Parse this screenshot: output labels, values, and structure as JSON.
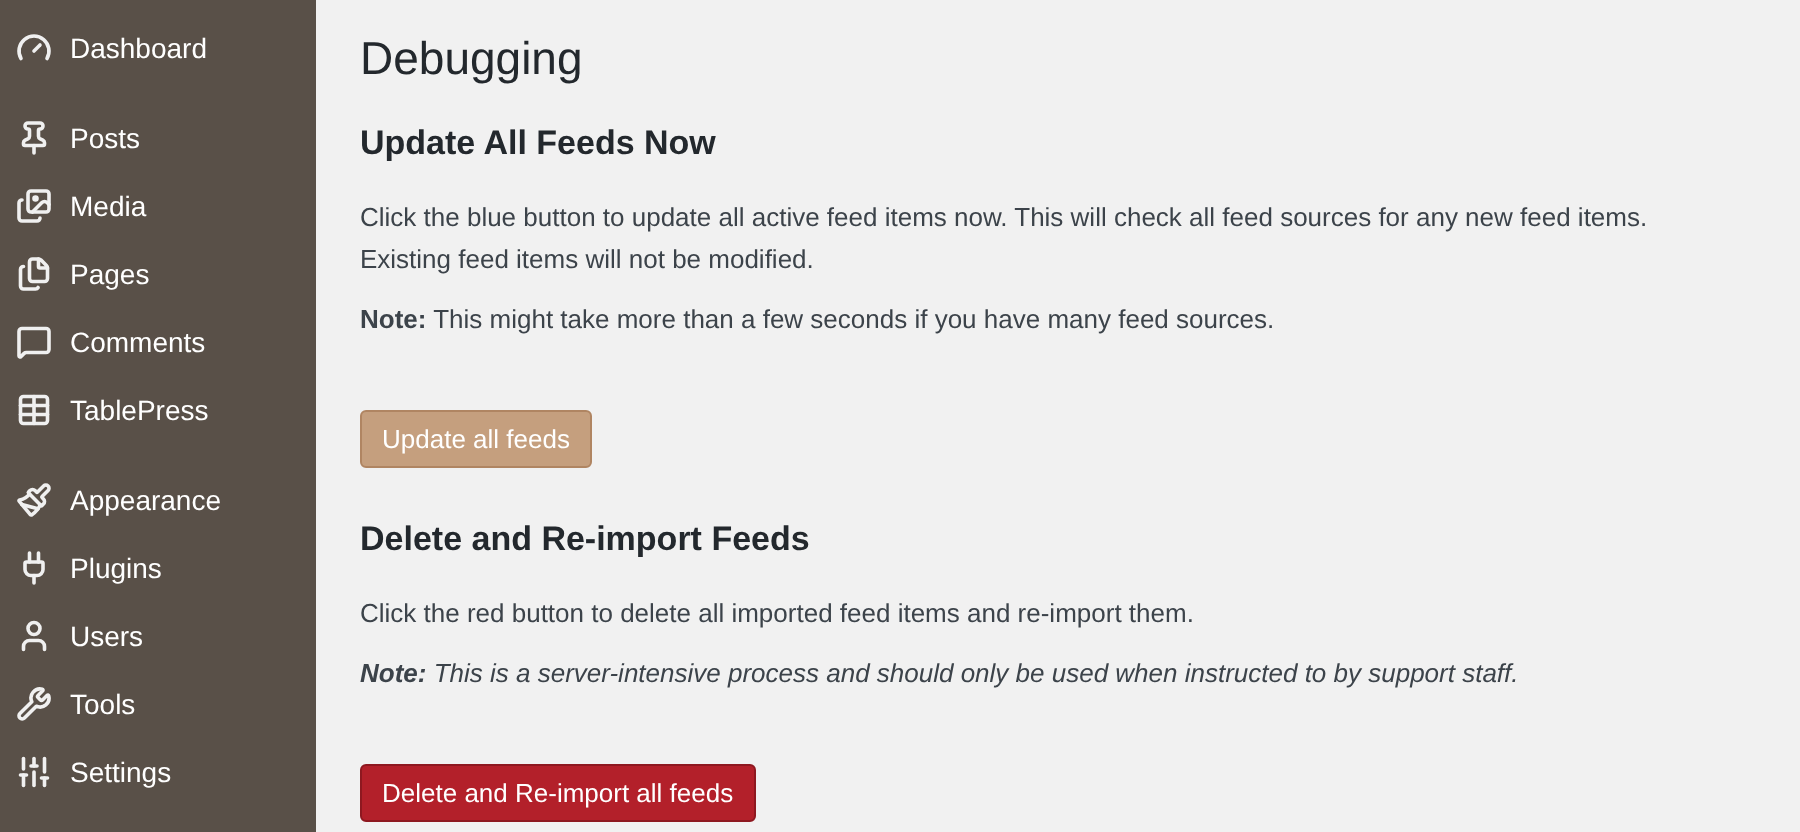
{
  "sidebar": {
    "groups": [
      {
        "items": [
          {
            "label": "Dashboard"
          }
        ]
      },
      {
        "items": [
          {
            "label": "Posts"
          },
          {
            "label": "Media"
          },
          {
            "label": "Pages"
          },
          {
            "label": "Comments"
          },
          {
            "label": "TablePress"
          }
        ]
      },
      {
        "items": [
          {
            "label": "Appearance"
          },
          {
            "label": "Plugins"
          },
          {
            "label": "Users"
          },
          {
            "label": "Tools"
          },
          {
            "label": "Settings"
          }
        ]
      }
    ]
  },
  "page_title": "Debugging",
  "sections": [
    {
      "heading": "Update All Feeds Now",
      "paragraphs": [
        {
          "text": "Click the blue button to update all active feed items now. This will check all feed sources for any new feed items. Existing feed items will not be modified.",
          "italic": false
        },
        {
          "text": "**Note:** This might take more than a few seconds if you have many feed sources.",
          "italic": false
        }
      ],
      "button": {
        "label": "Update all feeds",
        "kind": "primary"
      }
    },
    {
      "heading": "Delete and Re-import Feeds",
      "paragraphs": [
        {
          "text": "Click the red button to delete all imported feed items and re-import them.",
          "italic": false
        },
        {
          "text": "**Note:** This is a server-intensive process and should only be used when instructed to by support staff.",
          "italic": true
        }
      ],
      "button": {
        "label": "Delete and Re-import all feeds",
        "kind": "danger"
      }
    }
  ]
}
